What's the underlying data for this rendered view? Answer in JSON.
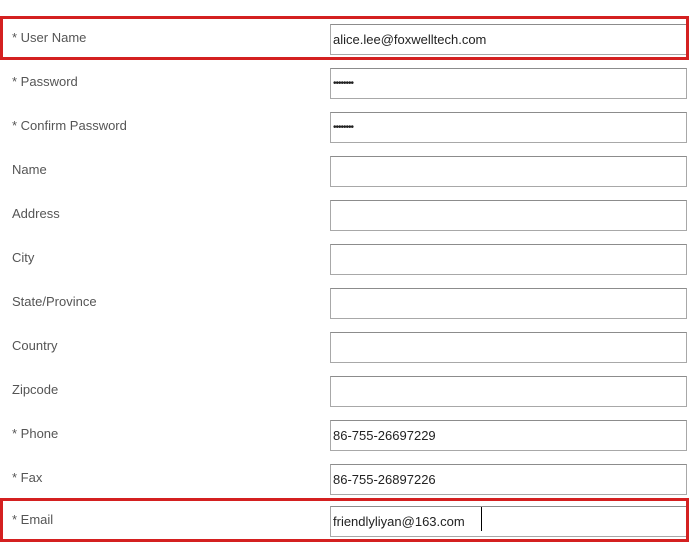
{
  "form": {
    "fields": [
      {
        "id": "user_name",
        "label": "* User Name",
        "value": "alice.lee@foxwelltech.com",
        "type": "text"
      },
      {
        "id": "password",
        "label": "* Password",
        "value": "••••••••",
        "type": "password"
      },
      {
        "id": "confirm_password",
        "label": "* Confirm Password",
        "value": "••••••••",
        "type": "password"
      },
      {
        "id": "name",
        "label": "Name",
        "value": "",
        "type": "text"
      },
      {
        "id": "address",
        "label": "Address",
        "value": "",
        "type": "text"
      },
      {
        "id": "city",
        "label": "City",
        "value": "",
        "type": "text"
      },
      {
        "id": "state_province",
        "label": "State/Province",
        "value": "",
        "type": "text"
      },
      {
        "id": "country",
        "label": "Country",
        "value": "",
        "type": "text"
      },
      {
        "id": "zipcode",
        "label": "Zipcode",
        "value": "",
        "type": "text"
      },
      {
        "id": "phone",
        "label": "* Phone",
        "value": "86-755-26697229",
        "type": "text"
      },
      {
        "id": "fax",
        "label": "* Fax",
        "value": "86-755-26897226",
        "type": "text"
      },
      {
        "id": "email",
        "label": "* Email",
        "value": "friendlyliyan@163.com",
        "type": "text"
      }
    ]
  },
  "highlight_color": "#d42020"
}
